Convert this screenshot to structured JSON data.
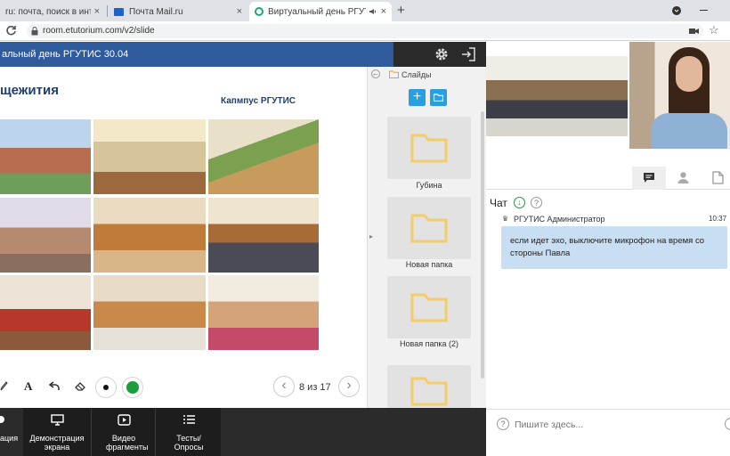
{
  "browser": {
    "tabs": [
      {
        "title": "ru: почта, поиск в интерне",
        "close": "×"
      },
      {
        "title": "Почта Mail.ru",
        "close": "×"
      },
      {
        "title": "Виртуальный день РГУТИС",
        "close": "×"
      }
    ],
    "new_tab": "+",
    "url": "room.etutorium.com/v2/slide"
  },
  "header": {
    "title": "альный день РГУТИС 30.04"
  },
  "slide": {
    "heading": "щежития",
    "campus_label": "Капмпус РГУТИС"
  },
  "slides_panel": {
    "title": "Слайды",
    "folders": [
      {
        "label": "Губина"
      },
      {
        "label": "Новая папка"
      },
      {
        "label": "Новая папка (2)"
      },
      {
        "label": ""
      }
    ]
  },
  "toolbar": {
    "text_tool": "A",
    "page_indicator": "8 из 17",
    "prev": "‹",
    "next": "›",
    "colors": {
      "black": "#111111",
      "green": "#1e9e3a"
    }
  },
  "bottombar": {
    "items": [
      {
        "label": "ация"
      },
      {
        "label": "Демонстрация экрана"
      },
      {
        "label": "Видео фрагменты"
      },
      {
        "label": "Тесты/ Опросы"
      }
    ]
  },
  "chat": {
    "title": "Чат",
    "messages": [
      {
        "author": "РГУТИС Администратор",
        "time": "10:37",
        "text": "если идет эхо, выключите микрофон на время со стороны Павла"
      }
    ],
    "input_placeholder": "Пишите здесь..."
  },
  "colors": {
    "header_blue": "#2f5a9c",
    "accent_blue": "#2a9ee0",
    "dark_bar": "#2b2b2b",
    "message_bg": "#c8def2",
    "folder_yellow": "#f4cc6a"
  }
}
